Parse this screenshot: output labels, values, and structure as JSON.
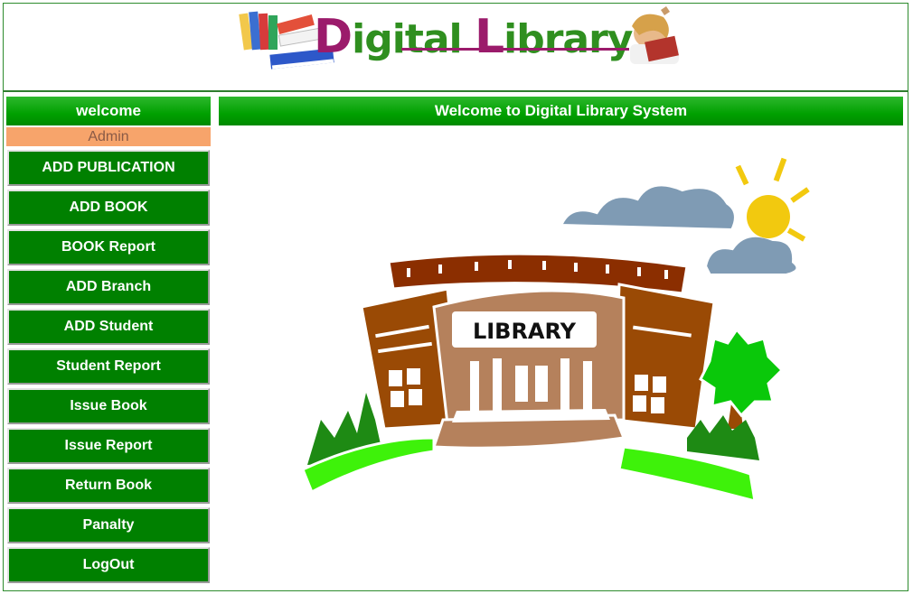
{
  "header": {
    "logo_part1": "D",
    "logo_part2": "igital ",
    "logo_part3": "L",
    "logo_part4": "ibrary"
  },
  "sidebar": {
    "welcome": "welcome",
    "user": "Admin",
    "items": [
      {
        "label": "ADD PUBLICATION"
      },
      {
        "label": "ADD BOOK"
      },
      {
        "label": "BOOK Report"
      },
      {
        "label": "ADD Branch"
      },
      {
        "label": "ADD Student"
      },
      {
        "label": "Student Report"
      },
      {
        "label": "Issue Book"
      },
      {
        "label": "Issue Report"
      },
      {
        "label": "Return Book"
      },
      {
        "label": "Panalty"
      },
      {
        "label": "LogOut"
      }
    ]
  },
  "main": {
    "title": "Welcome to Digital Library System",
    "sign_text": "LIBRARY"
  },
  "colors": {
    "nav_green": "#008000",
    "header_green": "#00a000",
    "admin_orange": "#f7a46b",
    "logo_purple": "#9b1b6b",
    "logo_green": "#2f8f1f"
  }
}
